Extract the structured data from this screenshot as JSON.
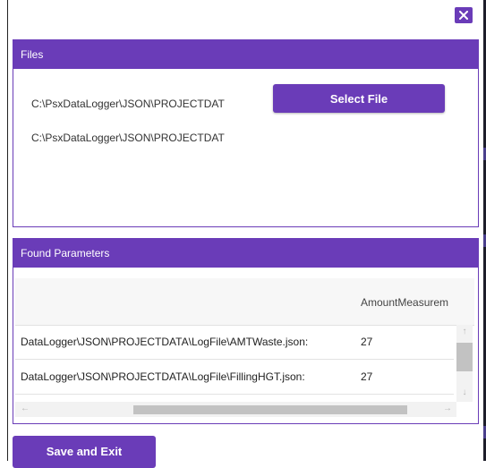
{
  "colors": {
    "accent": "#6a3cb8"
  },
  "dialog": {
    "close_icon": "close-icon"
  },
  "files": {
    "header": "Files",
    "paths": [
      "C:\\PsxDataLogger\\JSON\\PROJECTDAT",
      "C:\\PsxDataLogger\\JSON\\PROJECTDAT"
    ],
    "select_label": "Select File"
  },
  "params": {
    "header": "Found Parameters",
    "column_header": "AmountMeasurem",
    "rows": [
      {
        "file": ":DataLogger\\JSON\\PROJECTDATA\\LogFile\\AMTWaste.json",
        "value": "27"
      },
      {
        "file": ":DataLogger\\JSON\\PROJECTDATA\\LogFile\\FillingHGT.json",
        "value": "27"
      }
    ],
    "scroll_icons": [
      "arrow-up-icon",
      "arrow-down-icon",
      "arrow-left-icon",
      "arrow-right-icon"
    ]
  },
  "footer": {
    "save_label": "Save and Exit"
  }
}
